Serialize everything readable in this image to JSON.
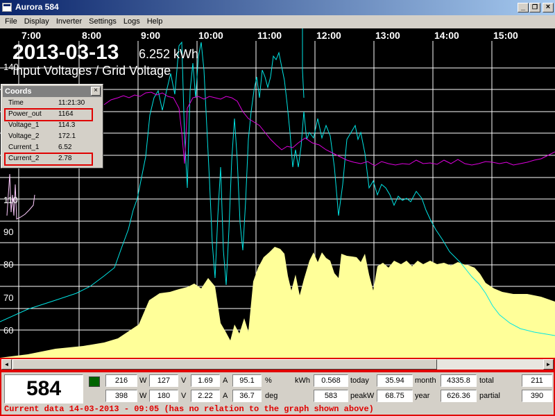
{
  "window": {
    "title": "Aurora 584",
    "buttons": {
      "minimize": "_",
      "restore": "❐",
      "close": "×"
    }
  },
  "menu": [
    "File",
    "Display",
    "Inverter",
    "Settings",
    "Logs",
    "Help"
  ],
  "graph": {
    "date": "2013-03-13",
    "energy": "6.252 kWh",
    "subtitle": "Input Voltages / Grid Voltage",
    "time_labels": [
      "7:00",
      "8:00",
      "9:00",
      "10:00",
      "11:00",
      "12:00",
      "13:00",
      "14:00",
      "15:00"
    ],
    "y_labels": [
      "140",
      "110",
      "90",
      "80",
      "70",
      "60"
    ],
    "colors": {
      "background": "#000000",
      "grid": "#ffffff",
      "power_fill": "#ffff99",
      "voltage_1": "#00e5e5",
      "grid_voltage": "#e000e0"
    }
  },
  "coords": {
    "title": "Coords",
    "close": "×",
    "rows": [
      {
        "key": "Time",
        "value": "11:21:30"
      },
      {
        "key": "Power_out",
        "value": "1164"
      },
      {
        "key": "Voltage_1",
        "value": "114.3"
      },
      {
        "key": "Voltage_2",
        "value": "172.1"
      },
      {
        "key": "Current_1",
        "value": "6.52"
      },
      {
        "key": "Current_2",
        "value": "2.78"
      }
    ]
  },
  "scrollbar": {
    "left": "◄",
    "right": "►"
  },
  "status": {
    "inverter": "584",
    "row1": [
      "216",
      "W",
      "127",
      "V",
      "1.69",
      "A",
      "95.1",
      "%",
      "kWh",
      "0.568",
      "today",
      "35.94",
      "month",
      "4335.8",
      "total",
      "211"
    ],
    "row2": [
      "398",
      "W",
      "180",
      "V",
      "2.22",
      "A",
      "36.7",
      "deg",
      "583",
      "peakW",
      "68.75",
      "year",
      "626.36",
      "partial",
      "390"
    ],
    "current_data": "Current data 14-03-2013 - 09:05 (has no relation to the graph shown above)"
  }
}
